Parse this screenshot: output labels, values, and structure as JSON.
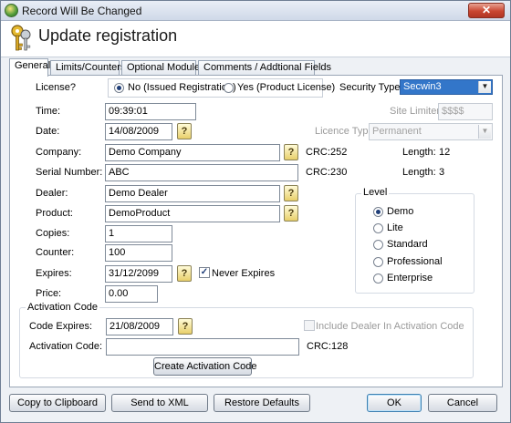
{
  "window": {
    "title": "Record Will Be Changed",
    "close_glyph": "✕",
    "app_icon": "app-globe-icon"
  },
  "header": {
    "title": "Update registration",
    "icon": "keys-icon"
  },
  "tabs": [
    "General",
    "Limits/Counters",
    "Optional Modules",
    "Comments / Addtional Fields"
  ],
  "general": {
    "license": {
      "label": "License?",
      "options": [
        "No (Issued Registration)",
        "Yes (Product License)"
      ],
      "selected_index": 0
    },
    "security_type": {
      "label": "Security Type:",
      "value": "Secwin3"
    },
    "time": {
      "label": "Time:",
      "value": "09:39:01"
    },
    "site_limiter": {
      "label": "Site Limiter:",
      "value": "$$$$"
    },
    "date": {
      "label": "Date:",
      "value": "14/08/2009"
    },
    "licence_type": {
      "label": "Licence Type:",
      "value": "Permanent"
    },
    "company": {
      "label": "Company:",
      "value": "Demo Company",
      "crc_label": "CRC:",
      "crc": "252",
      "length_label": "Length:",
      "length": "12"
    },
    "serial_number": {
      "label": "Serial Number:",
      "value": "ABC",
      "crc_label": "CRC:",
      "crc": "230",
      "length_label": "Length:",
      "length": "3"
    },
    "dealer": {
      "label": "Dealer:",
      "value": "Demo Dealer"
    },
    "product": {
      "label": "Product:",
      "value": "DemoProduct"
    },
    "copies": {
      "label": "Copies:",
      "value": "1"
    },
    "counter": {
      "label": "Counter:",
      "value": "100"
    },
    "expires": {
      "label": "Expires:",
      "value": "31/12/2099",
      "never_expires_label": "Never Expires",
      "never_expires_checked": true
    },
    "price": {
      "label": "Price:",
      "value": "0.00"
    },
    "level": {
      "label": "Level",
      "options": [
        "Demo",
        "Lite",
        "Standard",
        "Professional",
        "Enterprise"
      ],
      "selected_index": 0
    },
    "activation": {
      "group_label": "Activation Code",
      "code_expires_label": "Code Expires:",
      "code_expires_value": "21/08/2009",
      "include_dealer_label": "Include Dealer In Activation Code",
      "include_dealer_checked": false,
      "code_label": "Activation Code:",
      "code_value": "",
      "crc_label": "CRC:",
      "crc": "128",
      "create_button": "Create Activation Code"
    },
    "lookup_glyph": "?",
    "dropdown_glyph": "▼"
  },
  "footer": {
    "copy_clipboard": "Copy to Clipboard",
    "send_xml": "Send to XML",
    "restore_defaults": "Restore Defaults",
    "ok": "OK",
    "cancel": "Cancel"
  }
}
